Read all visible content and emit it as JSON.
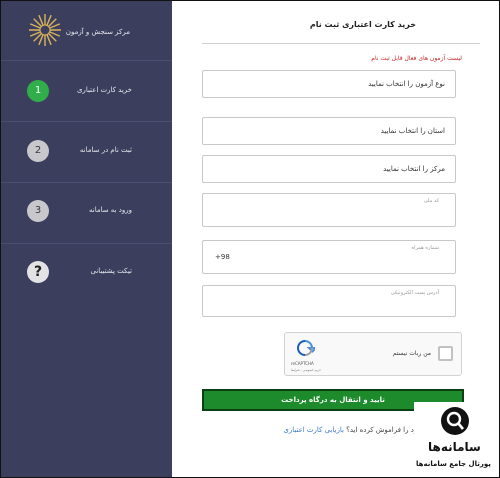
{
  "sidebar": {
    "title": "مرکز سنجش و آزمون",
    "steps": [
      {
        "number": "1",
        "label": "خرید کارت اعتباری"
      },
      {
        "number": "2",
        "label": "ثبت نام در سامانه"
      },
      {
        "number": "3",
        "label": "ورود به سامانه"
      },
      {
        "number": "?",
        "label": "تیکت پشتیبانی"
      }
    ]
  },
  "main": {
    "title": "خرید کارت اعتباری ثبت نام",
    "notice": "لیست آزمون های فعال قابل ثبت نام",
    "fields": {
      "exam_type": "نوع آزمون را انتخاب نمایید",
      "province": "استان را انتخاب نمایید",
      "center": "مرکز را انتخاب نمایید",
      "national_code_label": "کد ملی",
      "mobile_label": "شماره همراه",
      "mobile_prefix": "+98",
      "email_label": "آدرس پست الکترونیکی"
    },
    "captcha": {
      "label": "من ربات نیستم",
      "brand": "reCAPTCHA",
      "terms": "حریم خصوصی - شرایط"
    },
    "submit_label": "تایید و انتقال به درگاه پرداخت",
    "forgot_text": "کارت اعتباری خود را فراموش کرده اید؟",
    "forgot_link": "بازیابی کارت اعتباری"
  },
  "brand": {
    "name": "سامانه‌ها",
    "tagline": "پورتال جامع سامانه‌ها"
  },
  "colors": {
    "sidebar_bg": "#3b3f5d",
    "active_step": "#2fae4a",
    "submit_bg": "#1d8a2c",
    "notice": "#c62828",
    "link": "#3a78c9"
  }
}
